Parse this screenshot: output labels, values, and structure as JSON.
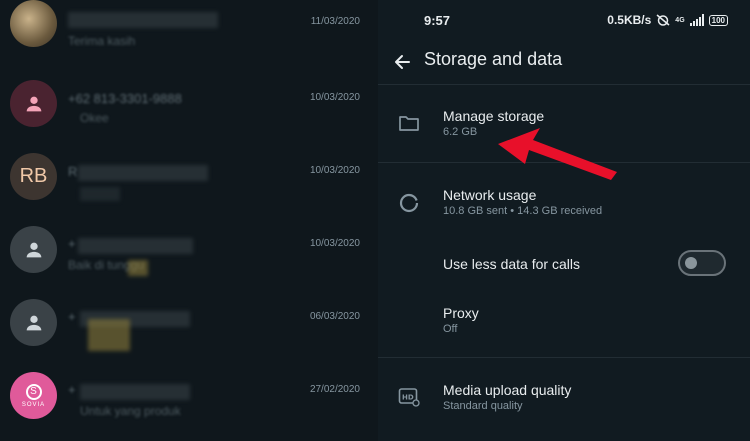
{
  "chat_list": {
    "rows": [
      {
        "date": "11/03/2020",
        "name_text": "+",
        "message_text": "Terima kasih"
      },
      {
        "date": "10/03/2020",
        "name_text": "+62 813-3301-9888",
        "message_text": "Okee"
      },
      {
        "date": "10/03/2020",
        "avatar_initials": "RB",
        "name_text": "R",
        "message_text": ""
      },
      {
        "date": "10/03/2020",
        "name_text": "+",
        "message_text": "Baik di tunggu"
      },
      {
        "date": "06/03/2020",
        "name_text": "+",
        "message_text": ""
      },
      {
        "date": "27/02/2020",
        "avatar_brand": "SOVIA",
        "avatar_glyph": "S",
        "name_text": "+",
        "message_text": "Untuk yang produk"
      }
    ]
  },
  "status_bar": {
    "time": "9:57",
    "speed": "0.5KB/s",
    "network": "4G",
    "battery": "100"
  },
  "app_bar": {
    "title": "Storage and data"
  },
  "settings": {
    "manage_storage": {
      "title": "Manage storage",
      "subtitle": "6.2 GB",
      "icon": "folder-icon"
    },
    "network_usage": {
      "title": "Network usage",
      "subtitle": "10.8 GB sent • 14.3 GB received",
      "icon": "data-usage-icon"
    },
    "less_data_calls": {
      "title": "Use less data for calls",
      "toggle_on": false
    },
    "proxy": {
      "title": "Proxy",
      "subtitle": "Off"
    },
    "media_upload_quality": {
      "title": "Media upload quality",
      "subtitle": "Standard quality",
      "icon": "hd-icon"
    }
  },
  "colors": {
    "background": "#111b21",
    "annotation_arrow": "#e8102a"
  }
}
